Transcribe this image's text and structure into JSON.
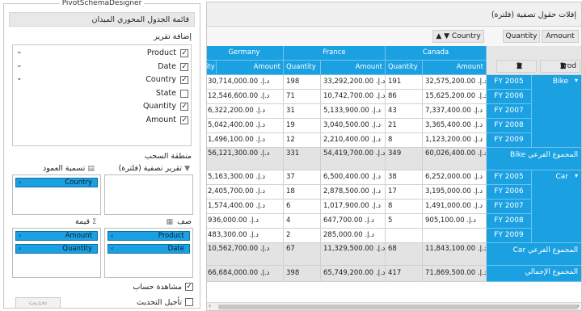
{
  "designer": {
    "legend": "PivotSchemaDesigner",
    "title": "قائمة الجدول المحوري الميدان",
    "add_to_report": "إضافة تقرير",
    "fields": [
      {
        "label": "Product",
        "checked": true,
        "expandable": true
      },
      {
        "label": "Date",
        "checked": true,
        "expandable": true
      },
      {
        "label": "Country",
        "checked": true,
        "expandable": true
      },
      {
        "label": "State",
        "checked": false,
        "expandable": false
      },
      {
        "label": "Quantity",
        "checked": true,
        "expandable": false
      },
      {
        "label": "Amount",
        "checked": true,
        "expandable": false
      }
    ],
    "drag_area_label": "منطقة السحب",
    "report_filter_label": "تقرير تصفية (فلترة)",
    "column_label": "تسمية العمود",
    "column_chips": [
      "Country"
    ],
    "row_label": "صف",
    "row_chips": [
      "Product",
      "Date"
    ],
    "value_label": "قيمة",
    "value_chips": [
      "Amount",
      "Quantity"
    ],
    "calc_view_label": "مشاهدة حساب",
    "calc_view_checked": true,
    "defer_label": "تأجيل التحديث",
    "defer_checked": false,
    "update_button": "تحديث"
  },
  "pivot": {
    "filter_area_label": "إفلات حقول تصفية (فلترة)",
    "country_button": "Country",
    "value_buttons": [
      "Quantity",
      "Amount"
    ],
    "row_buttons": [
      "Prod",
      "D"
    ],
    "countries": [
      "Canada",
      "France",
      "Germany"
    ],
    "partial_column": "ity",
    "col_quantity": "Quantity",
    "col_amount": "Amount",
    "currency": "د.إ.",
    "products": [
      {
        "name": "Bike",
        "rows": [
          {
            "year": "FY 2005",
            "canada_amt": "32,575,200.00",
            "canada_qty": "191",
            "france_amt": "33,292,200.00",
            "france_qty": "198",
            "germany_amt": "30,714,000.00"
          },
          {
            "year": "FY 2006",
            "canada_amt": "15,625,200.00",
            "canada_qty": "86",
            "france_amt": "10,742,700.00",
            "france_qty": "71",
            "germany_amt": "12,546,600.00"
          },
          {
            "year": "FY 2007",
            "canada_amt": "7,337,400.00",
            "canada_qty": "43",
            "france_amt": "5,133,900.00",
            "france_qty": "31",
            "germany_amt": "6,322,200.00"
          },
          {
            "year": "FY 2008",
            "canada_amt": "3,365,400.00",
            "canada_qty": "21",
            "france_amt": "3,040,500.00",
            "france_qty": "19",
            "germany_amt": "5,042,400.00"
          },
          {
            "year": "FY 2009",
            "canada_amt": "1,123,200.00",
            "canada_qty": "8",
            "france_amt": "2,210,400.00",
            "france_qty": "12",
            "germany_amt": "1,496,100.00"
          }
        ],
        "subtotal_label": "Bike المجموع الفرعي",
        "subtotal": {
          "canada_amt": "60,026,400.00",
          "canada_qty": "349",
          "france_amt": "54,419,700.00",
          "france_qty": "331",
          "germany_amt": "56,121,300.00"
        }
      },
      {
        "name": "Car",
        "rows": [
          {
            "year": "FY 2005",
            "canada_amt": "6,252,000.00",
            "canada_qty": "38",
            "france_amt": "6,500,400.00",
            "france_qty": "37",
            "germany_amt": "5,163,300.00"
          },
          {
            "year": "FY 2006",
            "canada_amt": "3,195,000.00",
            "canada_qty": "17",
            "france_amt": "2,878,500.00",
            "france_qty": "18",
            "germany_amt": "2,405,700.00"
          },
          {
            "year": "FY 2007",
            "canada_amt": "1,491,000.00",
            "canada_qty": "8",
            "france_amt": "1,017,900.00",
            "france_qty": "6",
            "germany_amt": "1,574,400.00"
          },
          {
            "year": "FY 2008",
            "canada_amt": "905,100.00",
            "canada_qty": "5",
            "france_amt": "647,700.00",
            "france_qty": "4",
            "germany_amt": "936,000.00"
          },
          {
            "year": "FY 2009",
            "canada_amt": "",
            "canada_qty": "",
            "france_amt": "285,000.00",
            "france_qty": "2",
            "germany_amt": "483,300.00"
          }
        ],
        "subtotal_label": "Car المجموع الفرعي",
        "subtotal": {
          "canada_amt": "11,843,100.00",
          "canada_qty": "68",
          "france_amt": "11,329,500.00",
          "france_qty": "67",
          "germany_amt": "10,562,700.00"
        }
      }
    ],
    "grand_total_label": "المجموع الإجمالي",
    "grand_total": {
      "canada_amt": "71,869,500.00",
      "canada_qty": "417",
      "france_amt": "65,749,200.00",
      "france_qty": "398",
      "germany_amt": "66,684,000.00"
    }
  }
}
